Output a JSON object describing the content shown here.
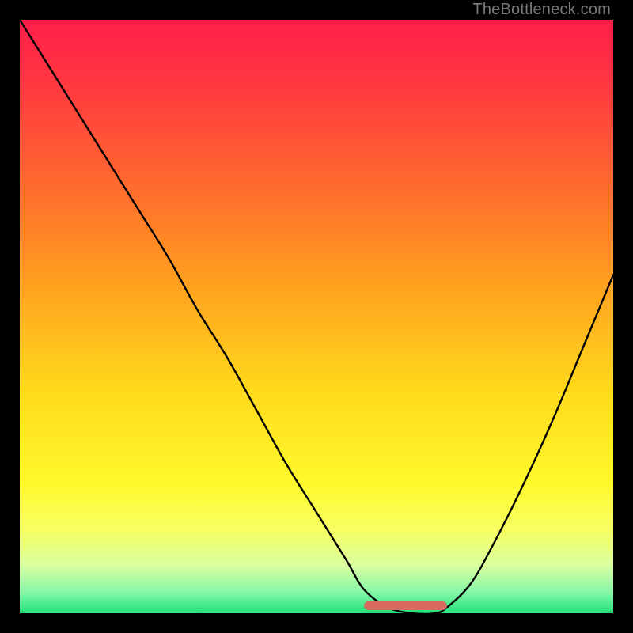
{
  "watermark": "TheBottleneck.com",
  "colors": {
    "frame": "#000000",
    "curve": "#000000",
    "marker": "#d86a62",
    "watermark": "#7a7a7a",
    "gradient_stops": [
      {
        "offset": 0.0,
        "color": "#ff1f4a"
      },
      {
        "offset": 0.12,
        "color": "#ff3b3f"
      },
      {
        "offset": 0.28,
        "color": "#ff6a2e"
      },
      {
        "offset": 0.45,
        "color": "#ffa21e"
      },
      {
        "offset": 0.62,
        "color": "#ffd81c"
      },
      {
        "offset": 0.78,
        "color": "#fff92b"
      },
      {
        "offset": 0.86,
        "color": "#f7ff63"
      },
      {
        "offset": 0.92,
        "color": "#d9ffa0"
      },
      {
        "offset": 0.965,
        "color": "#84f7a7"
      },
      {
        "offset": 1.0,
        "color": "#1ee27a"
      }
    ]
  },
  "chart_data": {
    "type": "line",
    "title": "",
    "xlabel": "",
    "ylabel": "",
    "xlim": [
      0,
      100
    ],
    "ylim": [
      0,
      100
    ],
    "x": [
      0,
      5,
      10,
      15,
      20,
      25,
      30,
      35,
      40,
      45,
      50,
      55,
      58,
      62,
      66,
      70,
      72,
      76,
      80,
      85,
      90,
      95,
      100
    ],
    "values": [
      100,
      92,
      84,
      76,
      68,
      60,
      51,
      43,
      34,
      25,
      17,
      9,
      4,
      1,
      0,
      0,
      1,
      5,
      12,
      22,
      33,
      45,
      57
    ],
    "minimum_range_x": [
      58,
      72
    ],
    "minimum_value": 0
  }
}
